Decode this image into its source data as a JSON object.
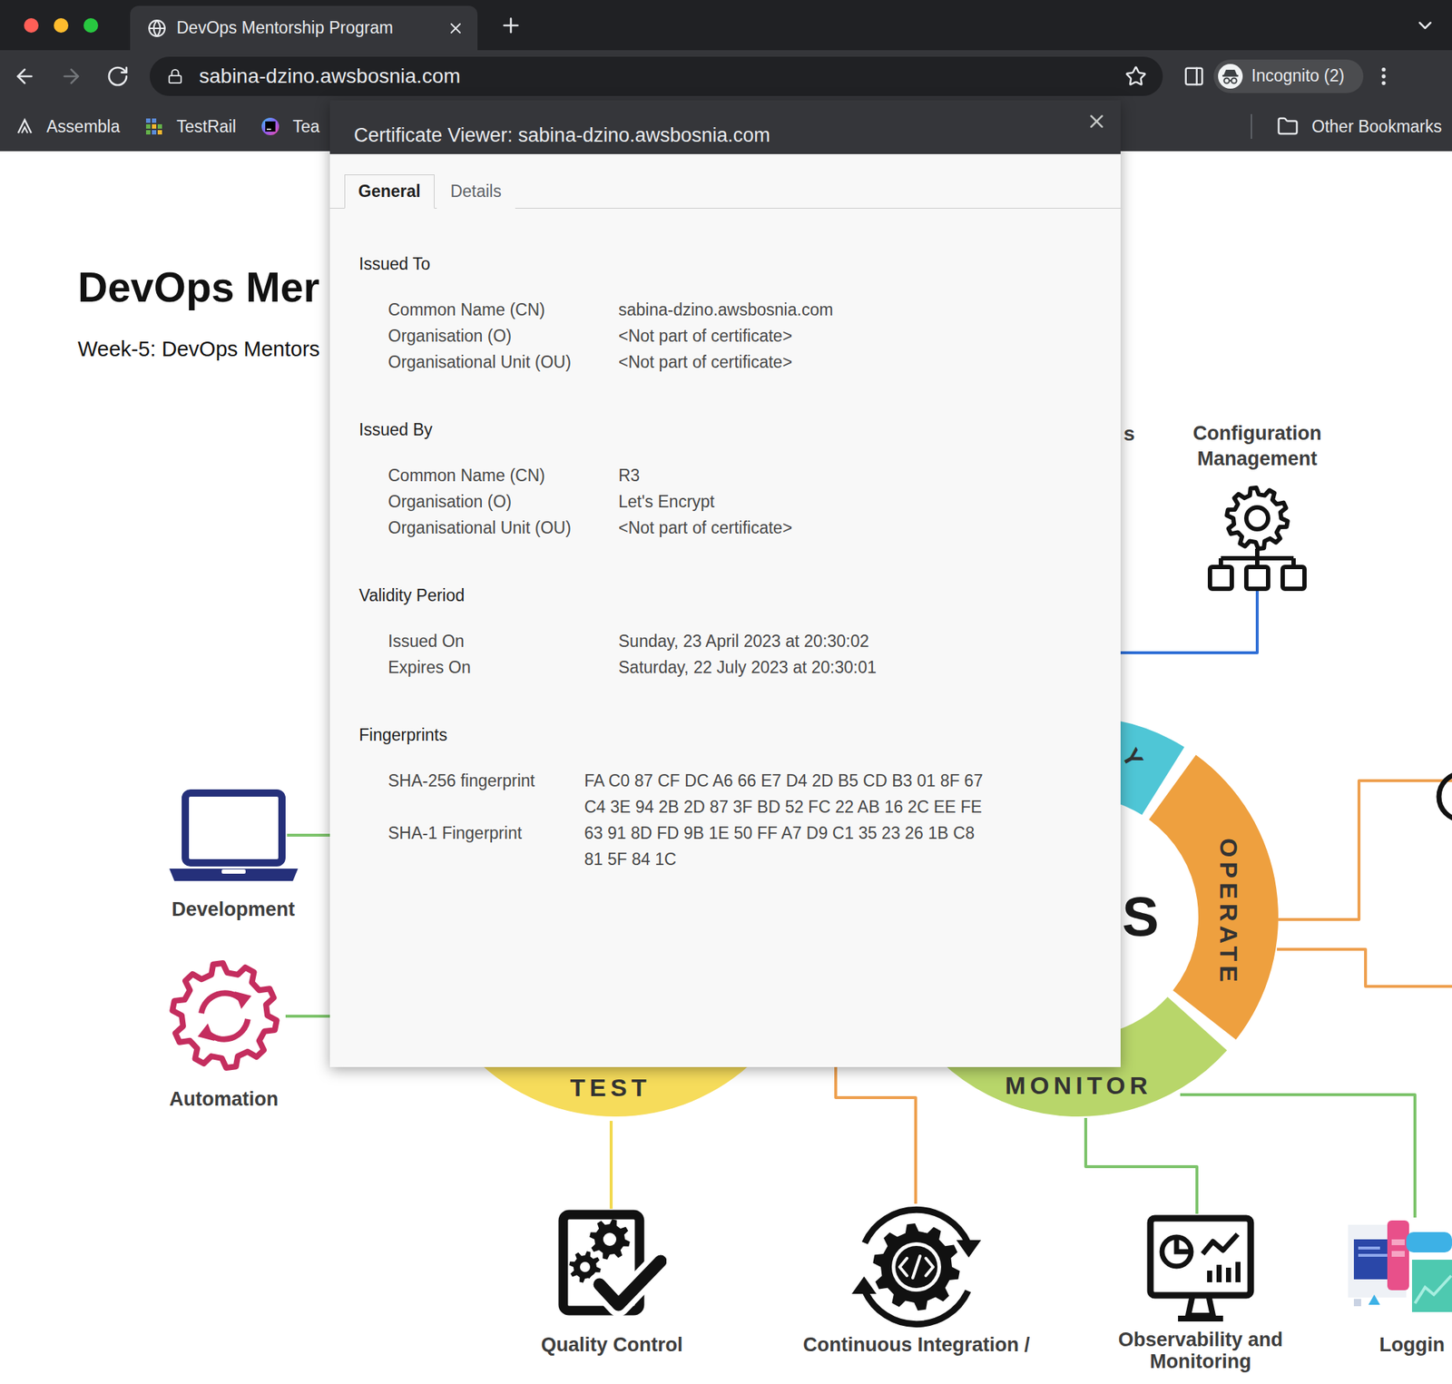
{
  "window": {
    "traffic_lights": [
      {
        "color": "#ff5f57"
      },
      {
        "color": "#febc2e"
      },
      {
        "color": "#28c840"
      }
    ]
  },
  "browser": {
    "tabs": [
      {
        "title": "DevOps Mentorship Program",
        "selected": true
      }
    ],
    "nav_buttons": [
      {
        "kind": "back",
        "disabled": false
      },
      {
        "kind": "forward",
        "disabled": true
      },
      {
        "kind": "reload",
        "disabled": false
      }
    ],
    "address": "sabina-dzino.awsbosnia.com",
    "bookmarked": false,
    "profile": "Incognito (2)",
    "bookmarks": [
      {
        "label": "Assembla",
        "kind": "assembla"
      },
      {
        "label": "TestRail",
        "kind": "testrail"
      },
      {
        "label": "Tea",
        "kind": "teamcity"
      }
    ],
    "other_bookmarks": "Other Bookmarks"
  },
  "page": {
    "heading": "DevOps Mer",
    "subheading": "Week-5: DevOps Mentors",
    "diagram": {
      "nodes": [
        {
          "label": "Development",
          "kind": "laptop"
        },
        {
          "label": "Automation",
          "kind": "automation"
        },
        {
          "label": "Configuration Management",
          "kind": "config"
        },
        {
          "label": "Quality Control",
          "kind": "quality"
        },
        {
          "label": "Continuous Integration /",
          "kind": "ci"
        },
        {
          "label": "Observability and Monitoring",
          "kind": "observability"
        },
        {
          "label": "Loggin",
          "kind": "logging"
        }
      ],
      "phases": [
        {
          "label": "TEST",
          "color": "#f6dc5b"
        },
        {
          "label": "Y",
          "color": "#4fc6d6"
        },
        {
          "label": "OPERATE",
          "color": "#eea03f"
        },
        {
          "label": "MONITOR",
          "color": "#b8d66a"
        }
      ],
      "fragments": [
        {
          "text": "s",
          "kind": "label"
        },
        {
          "text": "S",
          "kind": "title"
        }
      ]
    }
  },
  "dialog": {
    "title": "Certificate Viewer: sabina-dzino.awsbosnia.com",
    "tabs": [
      {
        "label": "General",
        "selected": true
      },
      {
        "label": "Details",
        "selected": false
      }
    ],
    "sections": [
      {
        "title": "Issued To",
        "kind": "fields",
        "rows": [
          {
            "label": "Common Name (CN)",
            "value": "sabina-dzino.awsbosnia.com"
          },
          {
            "label": "Organisation (O)",
            "value": "<Not part of certificate>"
          },
          {
            "label": "Organisational Unit (OU)",
            "value": "<Not part of certificate>"
          }
        ]
      },
      {
        "title": "Issued By",
        "kind": "fields",
        "rows": [
          {
            "label": "Common Name (CN)",
            "value": "R3"
          },
          {
            "label": "Organisation (O)",
            "value": "Let's Encrypt"
          },
          {
            "label": "Organisational Unit (OU)",
            "value": "<Not part of certificate>"
          }
        ]
      },
      {
        "title": "Validity Period",
        "kind": "fields",
        "rows": [
          {
            "label": "Issued On",
            "value": "Sunday, 23 April 2023 at 20:30:02"
          },
          {
            "label": "Expires On",
            "value": "Saturday, 22 July 2023 at 20:30:01"
          }
        ]
      },
      {
        "title": "Fingerprints",
        "kind": "fingerprints",
        "rows": [
          {
            "label": "SHA-256 fingerprint",
            "lines": [
              "FA C0 87 CF DC A6 66 E7 D4 2D B5 CD B3 01 8F 67",
              "C4 3E 94 2B 2D 87 3F BD 52 FC 22 AB 16 2C EE FE"
            ]
          },
          {
            "label": "SHA-1 Fingerprint",
            "lines": [
              "63 91 8D FD 9B 1E 50 FF A7 D9 C1 35 23 26 1B C8",
              "81 5F 84 1C"
            ]
          }
        ]
      }
    ]
  }
}
